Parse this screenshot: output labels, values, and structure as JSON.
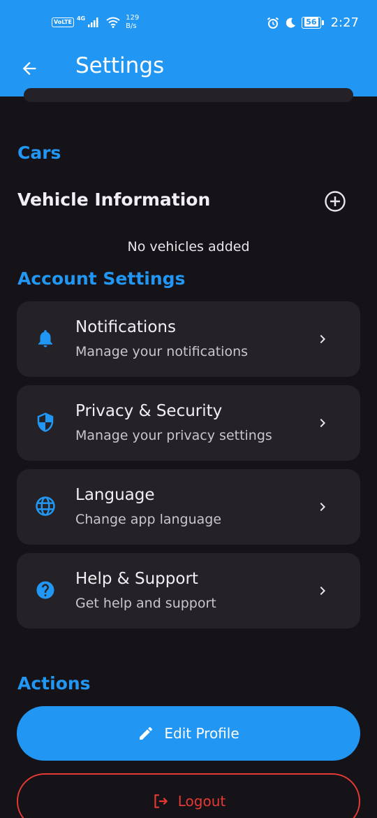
{
  "status_bar": {
    "volte": "VoLTE",
    "network": "4G",
    "speed_value": "129",
    "speed_unit": "B/s",
    "battery": "56",
    "time": "2:27"
  },
  "app_bar": {
    "title": "Settings",
    "back_icon": "arrow-back-icon"
  },
  "cars": {
    "section_title": "Cars",
    "vehicle_title": "Vehicle Information",
    "add_icon": "add-circle-icon",
    "empty_message": "No vehicles added"
  },
  "account_settings": {
    "section_title": "Account Settings",
    "items": [
      {
        "title": "Notifications",
        "subtitle": "Manage your notifications",
        "icon": "bell-icon"
      },
      {
        "title": "Privacy & Security",
        "subtitle": "Manage your privacy settings",
        "icon": "shield-icon"
      },
      {
        "title": "Language",
        "subtitle": "Change app language",
        "icon": "globe-icon"
      },
      {
        "title": "Help & Support",
        "subtitle": "Get help and support",
        "icon": "help-icon"
      }
    ]
  },
  "actions": {
    "section_title": "Actions",
    "edit_profile": "Edit Profile",
    "logout": "Logout"
  },
  "colors": {
    "accent": "#2196f3",
    "background": "#151317",
    "card": "#242226",
    "danger": "#e53935"
  }
}
